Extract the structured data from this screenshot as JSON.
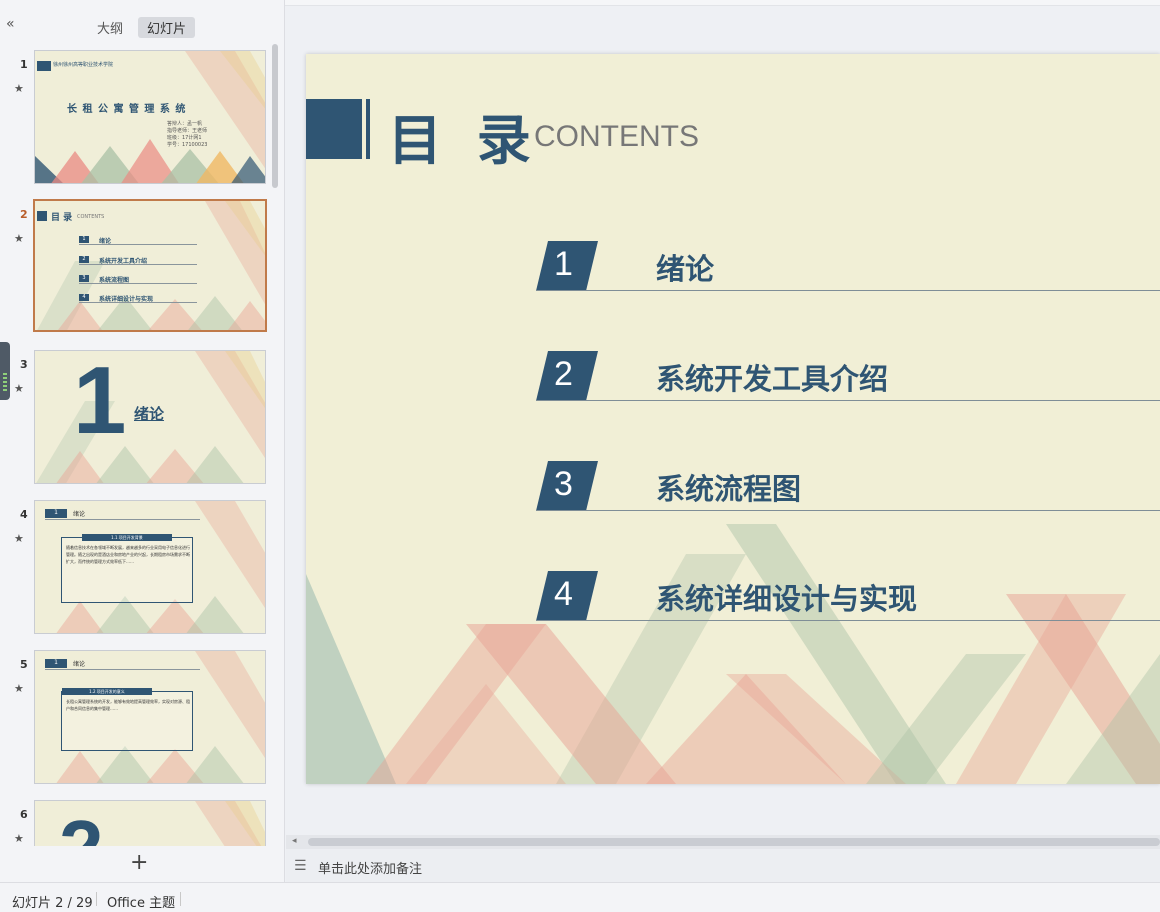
{
  "sidebar": {
    "collapse_icon": "«",
    "tabs": [
      {
        "label": "大纲",
        "active": false
      },
      {
        "label": "幻灯片",
        "active": true
      }
    ],
    "add_icon": "+",
    "thumbnails": [
      {
        "number": "1",
        "school": "徐州徐州高等职业技术学院",
        "title": "长 租 公 寓 管 理 系 统",
        "info": [
          "答辩人：孟一帆",
          "指导老师：王老师",
          "班级：17计网1",
          "学号：17100023"
        ]
      },
      {
        "number": "2",
        "title_cn": "目 录",
        "title_en": "CONTENTS",
        "items": [
          "绪论",
          "系统开发工具介绍",
          "系统流程图",
          "系统详细设计与实现"
        ],
        "item_numbers": [
          "1",
          "2",
          "3",
          "4"
        ]
      },
      {
        "number": "3",
        "big_number": "1",
        "heading": "绪论"
      },
      {
        "number": "4",
        "section_num": "1",
        "section_title": "绪论",
        "box_title": "1.1 项目开发背景",
        "box_text": "随着信息技术在各领域不断发展，越来越多的行业采用电子信息化进行管理。随之出现的是酒店业和房地产业的兴起，长期租房市场需求不断扩大，而传统的管理方式效率低下……"
      },
      {
        "number": "5",
        "section_num": "1",
        "section_title": "绪论",
        "box_title": "1.2 项目开发的意义",
        "box_text": "长租公寓管理系统的开发，能够有效地提高管理效率，实现对房源、租户和合同信息的集中管理……"
      },
      {
        "number": "6",
        "big_number": "2"
      }
    ],
    "star_icon": "★"
  },
  "slide": {
    "title_cn": "目 录",
    "title_en": "CONTENTS",
    "items": [
      {
        "num": "1",
        "text": "绪论"
      },
      {
        "num": "2",
        "text": "系统开发工具介绍"
      },
      {
        "num": "3",
        "text": "系统流程图"
      },
      {
        "num": "4",
        "text": "系统详细设计与实现"
      }
    ],
    "colors": {
      "accent": "#2f5573",
      "bg": "#f1efd6",
      "pink": "#e8a294",
      "green": "#a9c0a6"
    }
  },
  "notes": {
    "icon": "notes-icon",
    "placeholder": "单击此处添加备注"
  },
  "statusbar": {
    "slide_info": "幻灯片 2 / 29",
    "theme": "Office 主题"
  }
}
